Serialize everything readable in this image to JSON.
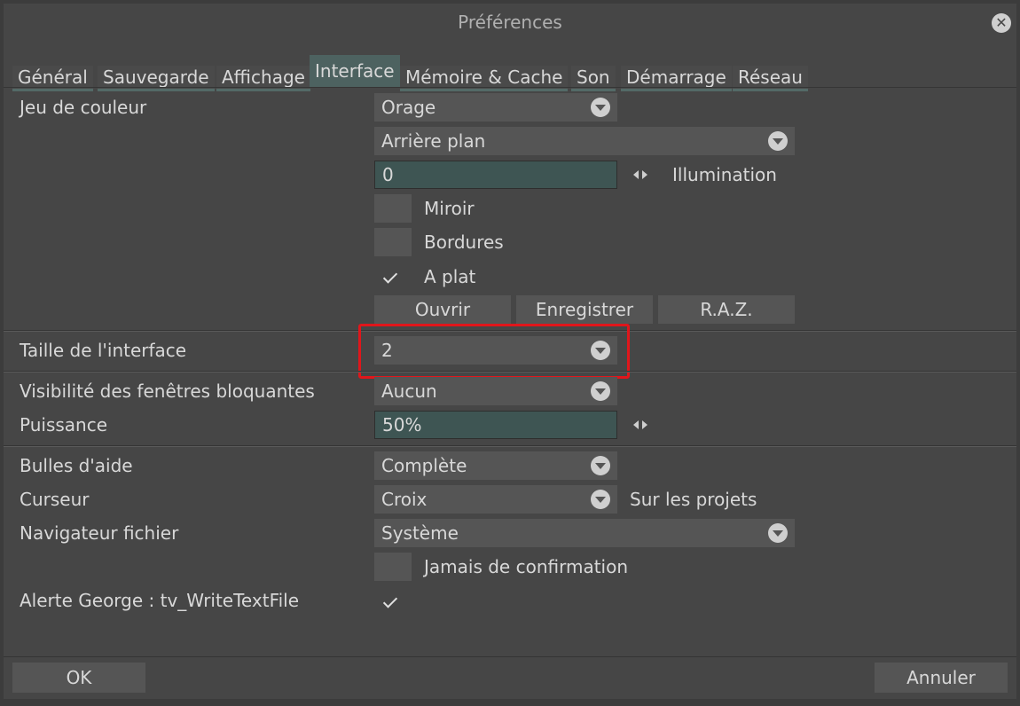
{
  "window": {
    "title": "Préférences"
  },
  "tabs": [
    {
      "label": "Général"
    },
    {
      "label": "Sauvegarde"
    },
    {
      "label": "Affichage"
    },
    {
      "label": "Interface",
      "active": true
    },
    {
      "label": "Mémoire & Cache"
    },
    {
      "label": "Son"
    },
    {
      "label": "Démarrage"
    },
    {
      "label": "Réseau"
    }
  ],
  "colors": {
    "accent": "#4d6260",
    "field_bg": "#3e5553",
    "highlight": "#e0161b"
  },
  "color_scheme": {
    "label": "Jeu de couleur",
    "scheme_value": "Orage",
    "layer_value": "Arrière plan",
    "illumination_value": "0",
    "illumination_label": "Illumination",
    "mirror_label": "Miroir",
    "mirror_checked": false,
    "borders_label": "Bordures",
    "borders_checked": false,
    "flat_label": "A plat",
    "flat_checked": true,
    "open_label": "Ouvrir",
    "save_label": "Enregistrer",
    "reset_label": "R.A.Z."
  },
  "interface_size": {
    "label": "Taille de l'interface",
    "value": "2"
  },
  "blocking_windows": {
    "label": "Visibilité des fenêtres bloquantes",
    "value": "Aucun",
    "power_label": "Puissance",
    "power_value": "50%"
  },
  "help": {
    "tooltips_label": "Bulles d'aide",
    "tooltips_value": "Complète",
    "cursor_label": "Curseur",
    "cursor_value": "Croix",
    "cursor_scope": "Sur les projets",
    "browser_label": "Navigateur fichier",
    "browser_value": "Système",
    "never_confirm_label": "Jamais de confirmation",
    "never_confirm_checked": false,
    "george_label": "Alerte George : tv_WriteTextFile",
    "george_checked": true
  },
  "footer": {
    "ok_label": "OK",
    "cancel_label": "Annuler"
  }
}
